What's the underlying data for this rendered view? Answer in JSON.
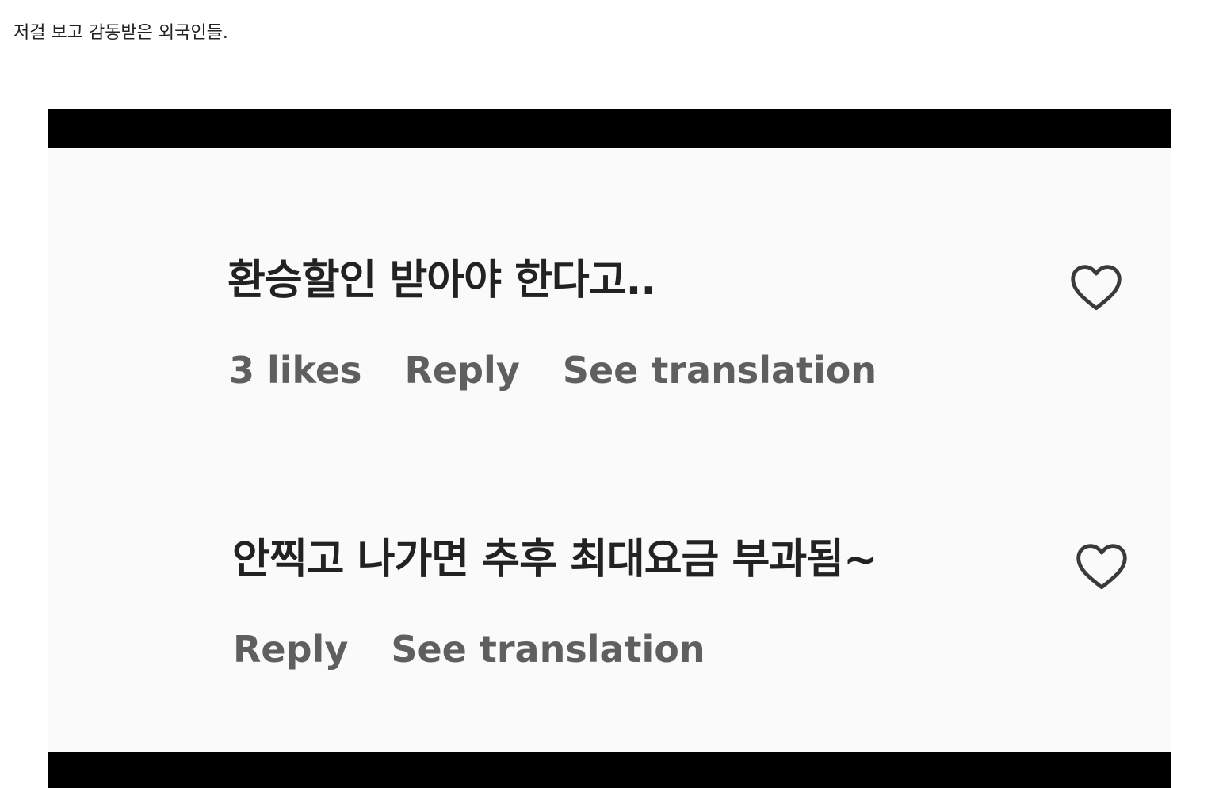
{
  "caption": "저걸 보고 감동받은 외국인들.",
  "comments": [
    {
      "text": "환승할인 받아야 한다고..",
      "likes": "3 likes",
      "reply": "Reply",
      "translate": "See translation",
      "like_icon": "heart-outline-icon"
    },
    {
      "text": "안찍고 나가면 추후 최대요금 부과됨~",
      "reply": "Reply",
      "translate": "See translation",
      "like_icon": "heart-outline-icon"
    }
  ],
  "colors": {
    "bars": "#000000",
    "comment_text": "#222222",
    "meta_text": "#5f5f5f",
    "background": "#fafafa"
  }
}
